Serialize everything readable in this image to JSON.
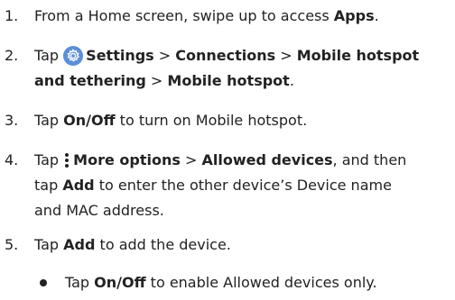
{
  "steps": [
    {
      "number": "1.",
      "line1": {
        "text1": "From a Home screen, swipe up to access ",
        "bold1": "Apps",
        "text2": "."
      }
    },
    {
      "number": "2.",
      "line1": {
        "text1": "Tap ",
        "icon": "settings-gear-icon",
        "bold1": "Settings",
        "sep1": " > ",
        "bold2": "Connections",
        "sep2": " > ",
        "bold3": "Mobile hotspot"
      },
      "line2": {
        "bold1": "and tethering",
        "sep1": " > ",
        "bold2": "Mobile hotspot",
        "text1": "."
      }
    },
    {
      "number": "3.",
      "line1": {
        "text1": "Tap ",
        "bold1": "On/Off",
        "text2": " to turn on Mobile hotspot."
      }
    },
    {
      "number": "4.",
      "line1": {
        "text1": "Tap ",
        "icon": "more-options-icon",
        "bold1": "More options",
        "sep1": " > ",
        "bold2": "Allowed devices",
        "text2": ", and then"
      },
      "line2": {
        "text1": "tap ",
        "bold1": "Add",
        "text2": " to enter the other device’s Device name"
      },
      "line3": {
        "text1": "and MAC address."
      }
    },
    {
      "number": "5.",
      "line1": {
        "text1": "Tap ",
        "bold1": "Add",
        "text2": " to add the device."
      }
    }
  ],
  "bullet": {
    "text1": "Tap ",
    "bold1": "On/Off",
    "text2": " to enable Allowed devices only."
  },
  "colors": {
    "text": "#222222",
    "settings_icon_bg": "#5b8fd8",
    "settings_icon_fg": "#ffffff"
  }
}
